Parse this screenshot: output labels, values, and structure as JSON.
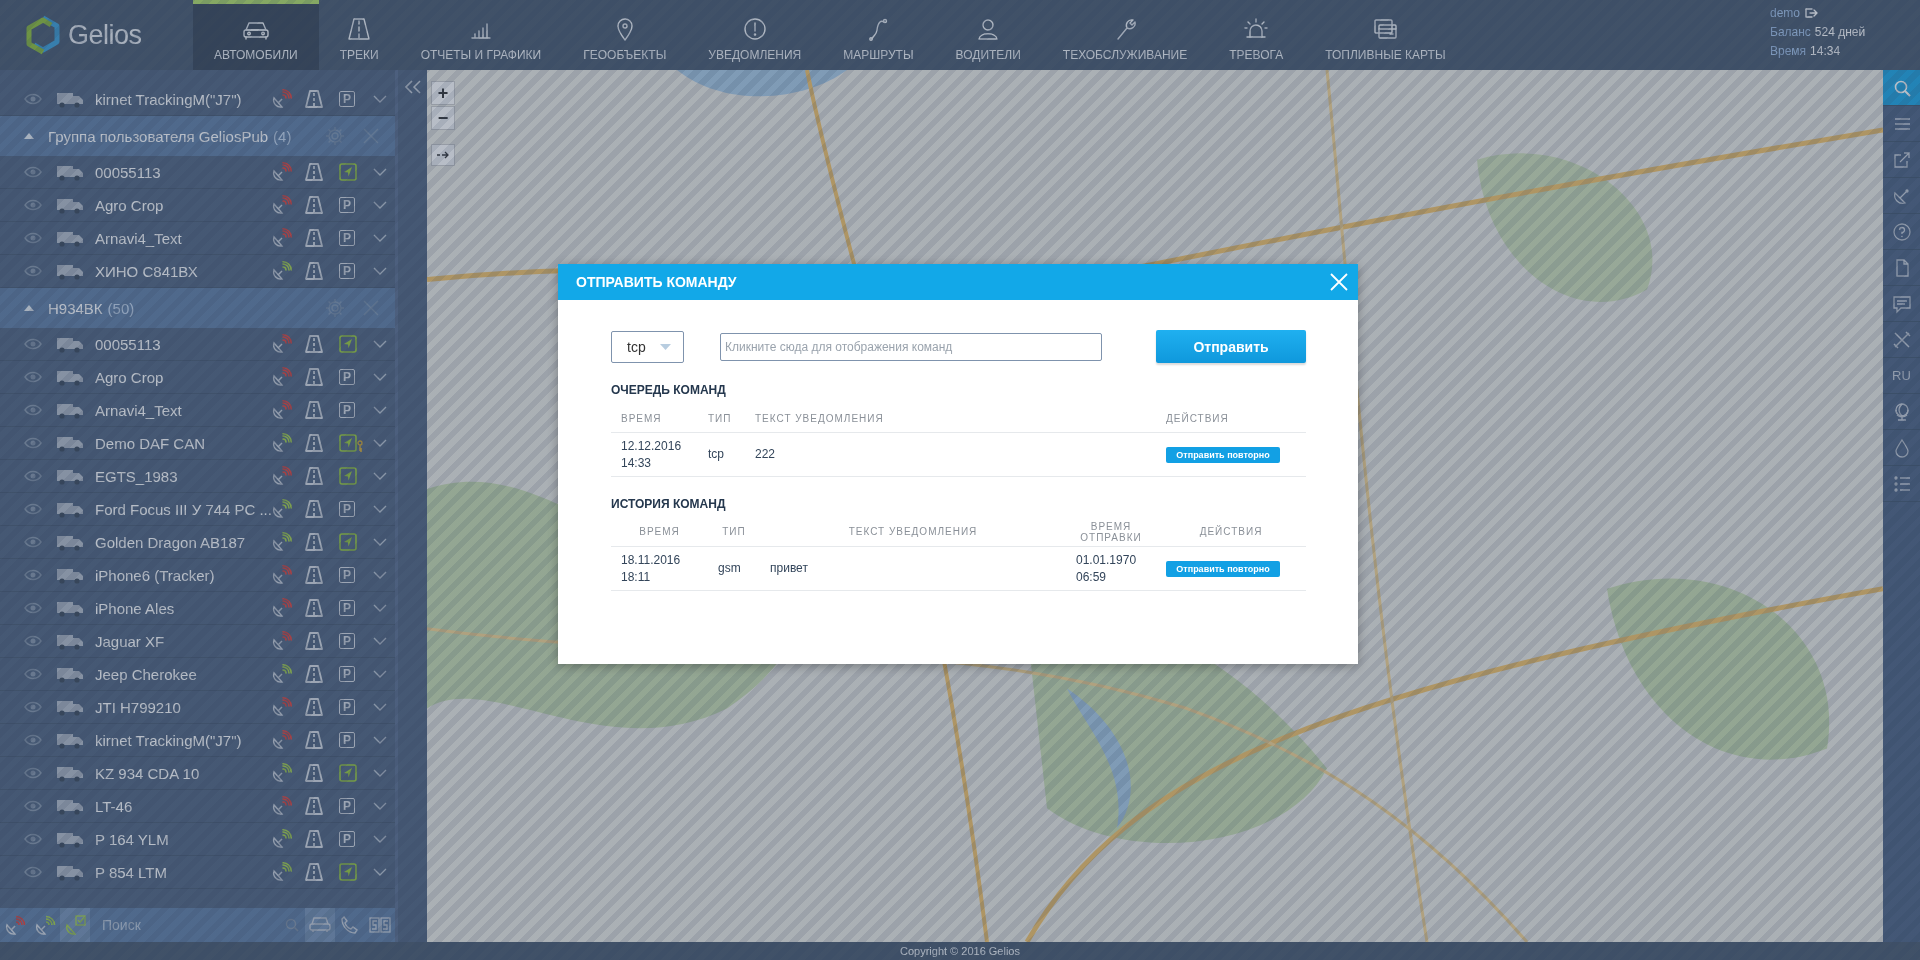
{
  "header": {
    "logo_text": "Gelios",
    "tabs": [
      {
        "kind": "car",
        "label": "АВТОМОБИЛИ",
        "selected": true
      },
      {
        "kind": "road",
        "label": "ТРЕКИ",
        "selected": false
      },
      {
        "kind": "chart",
        "label": "ОТЧЕТЫ И ГРАФИКИ",
        "selected": false
      },
      {
        "kind": "pin",
        "label": "ГЕООБЪЕКТЫ",
        "selected": false
      },
      {
        "kind": "alert",
        "label": "УВЕДОМЛЕНИЯ",
        "selected": false
      },
      {
        "kind": "route",
        "label": "МАРШРУТЫ",
        "selected": false
      },
      {
        "kind": "person",
        "label": "ВОДИТЕЛИ",
        "selected": false
      },
      {
        "kind": "wrench",
        "label": "ТЕХОБСЛУЖИВАНИЕ",
        "selected": false
      },
      {
        "kind": "siren",
        "label": "ТРЕВОГА",
        "selected": false
      },
      {
        "kind": "cards",
        "label": "ТОПЛИВНЫЕ КАРТЫ",
        "selected": false
      }
    ],
    "user": {
      "name": "demo",
      "balance_label": "Баланс",
      "balance": "524 дней",
      "time_label": "Время",
      "time": "14:34"
    }
  },
  "sidebar": {
    "vehicles": [
      {
        "name": "kirnet TrackingM(\"J7\")",
        "online": false,
        "status": {
          "kind": "parked",
          "label": "P"
        },
        "key": false
      }
    ],
    "groups": [
      {
        "name": "Группа пользователя GeliosPub",
        "count": "(4)",
        "expanded": true,
        "vehicles": [
          {
            "name": "00055113",
            "online": false,
            "status": {
              "kind": "moving"
            },
            "key": false
          },
          {
            "name": "Agro Crop",
            "online": false,
            "status": {
              "kind": "parked",
              "label": "P"
            },
            "key": false
          },
          {
            "name": "Arnavi4_Text",
            "online": false,
            "status": {
              "kind": "parked",
              "label": "P"
            },
            "key": false
          },
          {
            "name": "ХИНО С841ВХ",
            "online": true,
            "status": {
              "kind": "parked",
              "label": "P"
            },
            "key": false
          }
        ]
      },
      {
        "name": "Н934ВК",
        "count": "(50)",
        "expanded": true,
        "vehicles": [
          {
            "name": "00055113",
            "online": false,
            "status": {
              "kind": "moving"
            },
            "key": false
          },
          {
            "name": "Agro Crop",
            "online": false,
            "status": {
              "kind": "parked",
              "label": "P"
            },
            "key": false
          },
          {
            "name": "Arnavi4_Text",
            "online": false,
            "status": {
              "kind": "parked",
              "label": "P"
            },
            "key": false
          },
          {
            "name": "Demo DAF CAN",
            "online": true,
            "status": {
              "kind": "moving"
            },
            "key": true
          },
          {
            "name": "EGTS_1983",
            "online": false,
            "status": {
              "kind": "moving"
            },
            "key": false
          },
          {
            "name": "Ford Focus III У 744 РС ...",
            "online": true,
            "status": {
              "kind": "parked",
              "label": "P"
            },
            "key": false
          },
          {
            "name": "Golden Dragon AB187",
            "online": true,
            "status": {
              "kind": "moving"
            },
            "key": false
          },
          {
            "name": "iPhone6 (Tracker)",
            "online": false,
            "status": {
              "kind": "parked",
              "label": "P"
            },
            "key": false
          },
          {
            "name": "iPhone Ales",
            "online": false,
            "status": {
              "kind": "parked",
              "label": "P"
            },
            "key": false
          },
          {
            "name": "Jaguar XF",
            "online": false,
            "status": {
              "kind": "parked",
              "label": "P"
            },
            "key": false
          },
          {
            "name": "Jeep Cherokee",
            "online": true,
            "status": {
              "kind": "parked",
              "label": "P"
            },
            "key": false
          },
          {
            "name": "JTI H799210",
            "online": false,
            "status": {
              "kind": "parked",
              "label": "P"
            },
            "key": false
          },
          {
            "name": "kirnet TrackingM(\"J7\")",
            "online": false,
            "status": {
              "kind": "parked",
              "label": "P"
            },
            "key": false
          },
          {
            "name": "KZ 934 CDA 10",
            "online": true,
            "status": {
              "kind": "moving"
            },
            "key": false
          },
          {
            "name": "LT-46",
            "online": false,
            "status": {
              "kind": "parked",
              "label": "P"
            },
            "key": false
          },
          {
            "name": "P 164 YLM",
            "online": true,
            "status": {
              "kind": "parked",
              "label": "P"
            },
            "key": false
          },
          {
            "name": "P 854 LTM",
            "online": true,
            "status": {
              "kind": "moving"
            },
            "key": false
          }
        ]
      }
    ],
    "filters": [
      {
        "kind": "offline",
        "selected": false
      },
      {
        "kind": "online",
        "selected": false
      },
      {
        "kind": "checked",
        "selected": true
      }
    ],
    "search": {
      "placeholder": "Поиск"
    },
    "views": [
      {
        "kind": "car",
        "selected": true
      },
      {
        "kind": "phone",
        "selected": false
      },
      {
        "kind": "split",
        "selected": false
      }
    ]
  },
  "map": {
    "kind": "picture",
    "zoom_in": "+",
    "zoom_out": "−"
  },
  "toolbar": [
    {
      "kind": "search",
      "selected": true
    },
    {
      "kind": "menu",
      "selected": false
    },
    {
      "kind": "export",
      "selected": false
    },
    {
      "kind": "satellite",
      "selected": false
    },
    {
      "kind": "help",
      "selected": false
    },
    {
      "kind": "document",
      "selected": false
    },
    {
      "kind": "chat",
      "selected": false
    },
    {
      "kind": "tools",
      "selected": false
    },
    {
      "kind": "language",
      "label": "RU",
      "selected": false
    },
    {
      "kind": "globe",
      "selected": false
    },
    {
      "kind": "drop",
      "selected": false
    },
    {
      "kind": "list",
      "selected": false
    }
  ],
  "footer": "Copyright © 2016 Gelios",
  "dialog": {
    "title": "ОТПРАВИТЬ КОМАНДУ",
    "channel": "tcp",
    "command_placeholder": "Кликните сюда для отображения команд",
    "send_button": "Отправить",
    "queue": {
      "title": "ОЧЕРЕДЬ КОМАНД",
      "columns": [
        "ВРЕМЯ",
        "ТИП",
        "ТЕКСТ УВЕДОМЛЕНИЯ",
        "ДЕЙСТВИЯ"
      ],
      "rows": [
        {
          "time": "12.12.2016 14:33",
          "type": "tcp",
          "text": "222",
          "action": "Отправить повторно"
        }
      ]
    },
    "history": {
      "title": "ИСТОРИЯ КОМАНД",
      "columns": [
        "ВРЕМЯ",
        "ТИП",
        "ТЕКСТ УВЕДОМЛЕНИЯ",
        "ВРЕМЯ ОТПРАВКИ",
        "ДЕЙСТВИЯ"
      ],
      "rows": [
        {
          "time": "18.11.2016 18:11",
          "type": "gsm",
          "text": "привет",
          "sent": "01.01.1970 06:59",
          "action": "Отправить повторно"
        }
      ]
    }
  }
}
